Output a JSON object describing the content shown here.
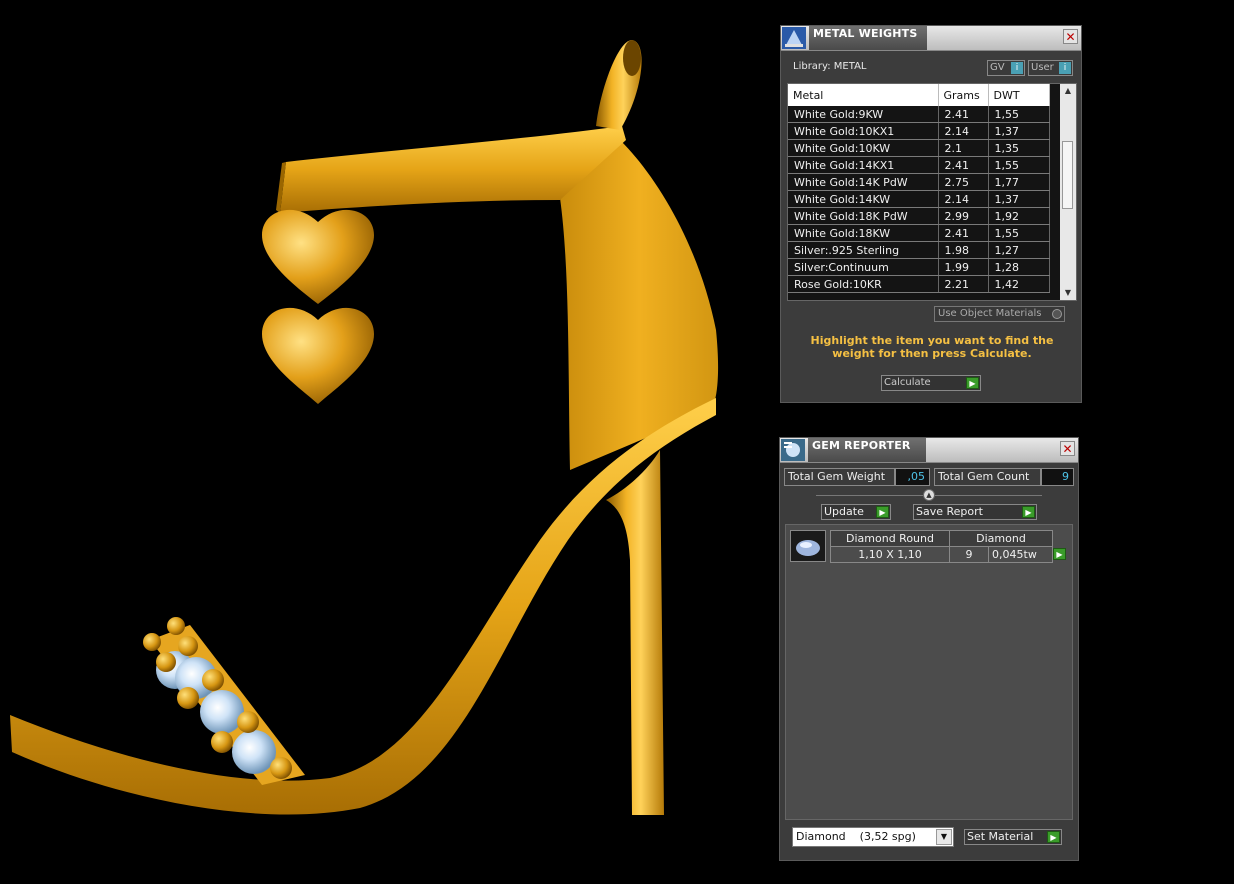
{
  "metal_weights": {
    "title": "METAL WEIGHTS",
    "library_label": "Library: METAL",
    "toggle_gv": "GV",
    "toggle_user": "User",
    "columns": [
      "Metal",
      "Grams",
      "DWT"
    ],
    "rows": [
      [
        "White Gold:9KW",
        "2.41",
        "1,55"
      ],
      [
        "White Gold:10KX1",
        "2.14",
        "1,37"
      ],
      [
        "White Gold:10KW",
        "2.1",
        "1,35"
      ],
      [
        "White Gold:14KX1",
        "2.41",
        "1,55"
      ],
      [
        "White Gold:14K PdW",
        "2.75",
        "1,77"
      ],
      [
        "White Gold:14KW",
        "2.14",
        "1,37"
      ],
      [
        "White Gold:18K PdW",
        "2.99",
        "1,92"
      ],
      [
        "White Gold:18KW",
        "2.41",
        "1,55"
      ],
      [
        "Silver:.925 Sterling",
        "1.98",
        "1,27"
      ],
      [
        "Silver:Continuum",
        "1.99",
        "1,28"
      ],
      [
        "Rose Gold:10KR",
        "2.21",
        "1,42"
      ]
    ],
    "use_object_materials": "Use Object Materials",
    "hint": "Highlight the item you want to find the weight for then press Calculate.",
    "calculate_label": "Calculate"
  },
  "gem_reporter": {
    "title": "GEM REPORTER",
    "total_weight_label": "Total Gem Weight",
    "total_weight_value": ",05",
    "total_count_label": "Total Gem Count",
    "total_count_value": "9",
    "update_label": "Update",
    "save_report_label": "Save Report",
    "gem": {
      "shape": "Diamond Round",
      "size": "1,10 X 1,10",
      "material": "Diamond",
      "count": "9",
      "weight": "0,045tw"
    },
    "material_select": "Diamond    (3,52 spg)",
    "set_material_label": "Set Material"
  },
  "colors": {
    "gold": "#e8a81c",
    "hint_text": "#f5c043",
    "value_cyan": "#4ec3e8",
    "go_green": "#3a9c2a"
  }
}
